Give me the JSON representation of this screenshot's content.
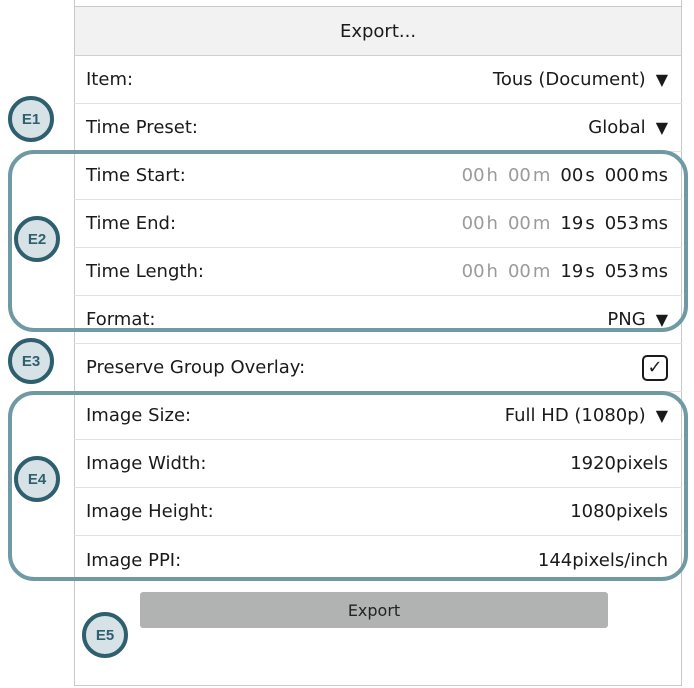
{
  "dialog": {
    "title": "Export..."
  },
  "rows": {
    "item": {
      "label": "Item:",
      "value": "Tous (Document)"
    },
    "time_preset": {
      "label": "Time Preset:",
      "value": "Global"
    },
    "time_start": {
      "label": "Time Start:",
      "h": "00",
      "m": "00",
      "s": "00",
      "ms": "000"
    },
    "time_end": {
      "label": "Time End:",
      "h": "00",
      "m": "00",
      "s": "19",
      "ms": "053"
    },
    "time_length": {
      "label": "Time Length:",
      "h": "00",
      "m": "00",
      "s": "19",
      "ms": "053"
    },
    "format": {
      "label": "Format:",
      "value": "PNG"
    },
    "preserve_group_overlay": {
      "label": "Preserve Group Overlay:",
      "checked": true
    },
    "image_size": {
      "label": "Image Size:",
      "value": "Full HD (1080p)"
    },
    "image_width": {
      "label": "Image Width:",
      "value": "1920pixels"
    },
    "image_height": {
      "label": "Image Height:",
      "value": "1080pixels"
    },
    "image_ppi": {
      "label": "Image PPI:",
      "value": "144pixels/inch"
    }
  },
  "units": {
    "h": "h",
    "m": "m",
    "s": "s",
    "ms": "ms"
  },
  "glyphs": {
    "dropdown_arrow": "▼",
    "check": "✓"
  },
  "export_button": {
    "label": "Export"
  },
  "badges": {
    "e1": "E1",
    "e2": "E2",
    "e3": "E3",
    "e4": "E4",
    "e5": "E5"
  },
  "colors": {
    "outline": "#6f9aa4",
    "badge_border": "#2e5f6e",
    "badge_fill": "#d7e2e6",
    "button": "#b1b3b2"
  }
}
